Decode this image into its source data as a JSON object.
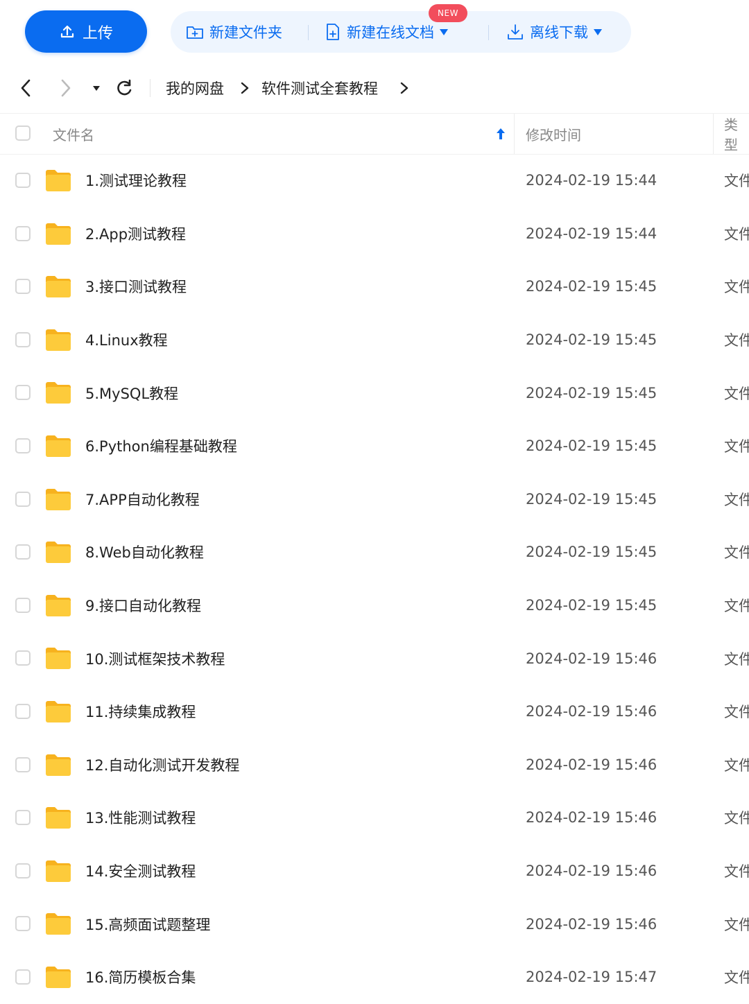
{
  "toolbar": {
    "upload_label": "上传",
    "new_folder_label": "新建文件夹",
    "new_doc_label": "新建在线文档",
    "new_badge": "NEW",
    "offline_download_label": "离线下载",
    "accent": "#0a6cf0"
  },
  "breadcrumb": {
    "root": "我的网盘",
    "current": "软件测试全套教程"
  },
  "columns": {
    "name": "文件名",
    "modified": "修改时间",
    "type": "类型"
  },
  "files": [
    {
      "name": "1.测试理论教程",
      "modified": "2024-02-19 15:44",
      "type": "文件夹"
    },
    {
      "name": "2.App测试教程",
      "modified": "2024-02-19 15:44",
      "type": "文件夹"
    },
    {
      "name": "3.接口测试教程",
      "modified": "2024-02-19 15:45",
      "type": "文件夹"
    },
    {
      "name": "4.Linux教程",
      "modified": "2024-02-19 15:45",
      "type": "文件夹"
    },
    {
      "name": "5.MySQL教程",
      "modified": "2024-02-19 15:45",
      "type": "文件夹"
    },
    {
      "name": "6.Python编程基础教程",
      "modified": "2024-02-19 15:45",
      "type": "文件夹"
    },
    {
      "name": "7.APP自动化教程",
      "modified": "2024-02-19 15:45",
      "type": "文件夹"
    },
    {
      "name": "8.Web自动化教程",
      "modified": "2024-02-19 15:45",
      "type": "文件夹"
    },
    {
      "name": "9.接口自动化教程",
      "modified": "2024-02-19 15:45",
      "type": "文件夹"
    },
    {
      "name": "10.测试框架技术教程",
      "modified": "2024-02-19 15:46",
      "type": "文件夹"
    },
    {
      "name": "11.持续集成教程",
      "modified": "2024-02-19 15:46",
      "type": "文件夹"
    },
    {
      "name": "12.自动化测试开发教程",
      "modified": "2024-02-19 15:46",
      "type": "文件夹"
    },
    {
      "name": "13.性能测试教程",
      "modified": "2024-02-19 15:46",
      "type": "文件夹"
    },
    {
      "name": "14.安全测试教程",
      "modified": "2024-02-19 15:46",
      "type": "文件夹"
    },
    {
      "name": "15.高频面试题整理",
      "modified": "2024-02-19 15:46",
      "type": "文件夹"
    },
    {
      "name": "16.简历模板合集",
      "modified": "2024-02-19 15:47",
      "type": "文件夹"
    }
  ]
}
